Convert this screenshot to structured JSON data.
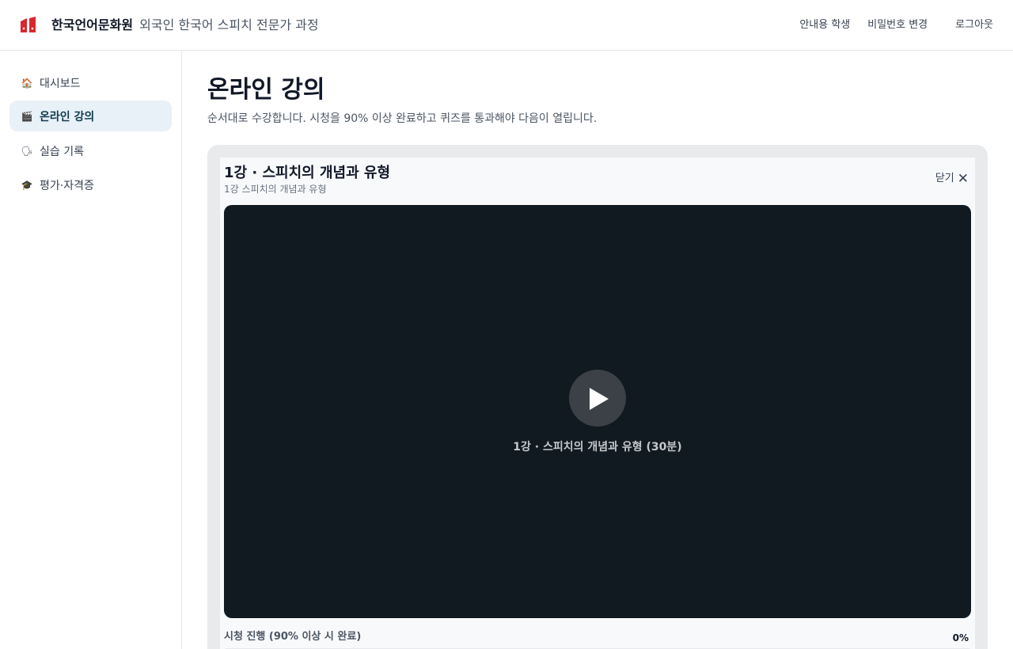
{
  "header": {
    "brand_name": "한국언어문화원",
    "program": "외국인 한국어 스피치 전문가 과정",
    "user_label": "안내용 학생",
    "change_password": "비밀번호 변경",
    "logout": "로그아웃",
    "accent_color": "#d9272e"
  },
  "sidebar": {
    "items": [
      {
        "icon": "house-icon",
        "label": "대시보드",
        "active": false
      },
      {
        "icon": "clapper-icon",
        "label": "온라인 강의",
        "active": true
      },
      {
        "icon": "speaking-head-icon",
        "label": "실습 기록",
        "active": false
      },
      {
        "icon": "graduation-cap-icon",
        "label": "평가·자격증",
        "active": false
      }
    ]
  },
  "main": {
    "title": "온라인 강의",
    "description": "순서대로 수강합니다. 시청을 90% 이상 완료하고 퀴즈를 통과해야 다음이 열립니다."
  },
  "lesson": {
    "title": "1강 · 스피치의 개념과 유형",
    "subtitle": "1강 스피치의 개념과 유형",
    "close_label": "닫기",
    "video_caption": "1강 ·  스피치의 개념과 유형 (30분)",
    "progress_label": "시청 진행 (90% 이상 시 완료)",
    "progress_value": "0%",
    "progress_fraction": 0
  }
}
